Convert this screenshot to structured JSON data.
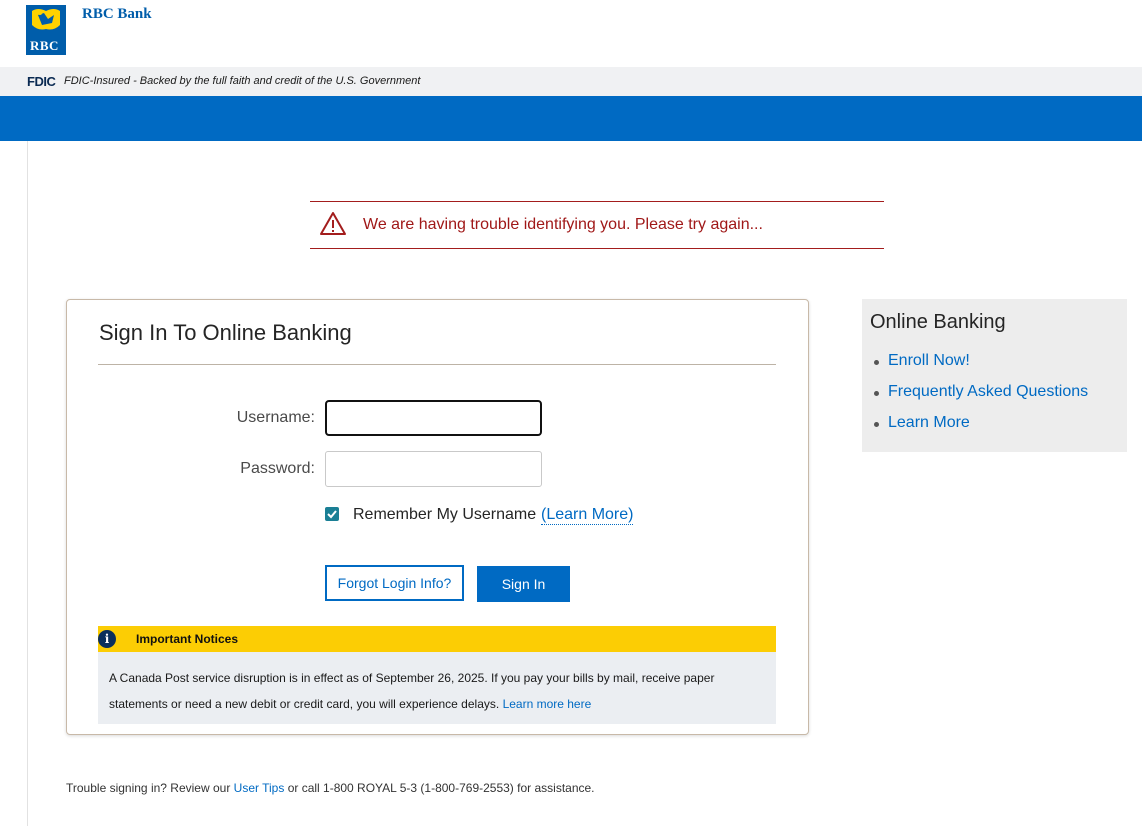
{
  "header": {
    "logo_text": "RBC",
    "brand_name": "RBC Bank",
    "fdic_logo": "FDIC",
    "fdic_text": "FDIC-Insured - Backed by the full faith and credit of the U.S. Government"
  },
  "error": {
    "icon": "warning-triangle-icon",
    "message": "We are having trouble identifying you. Please try again..."
  },
  "signin": {
    "title": "Sign In To Online Banking",
    "username_label": "Username:",
    "username_value": "",
    "password_label": "Password:",
    "password_value": "",
    "remember_checked": true,
    "remember_label": "Remember My Username",
    "learn_more_label": "(Learn More)",
    "forgot_button": "Forgot Login Info?",
    "signin_button": "Sign In"
  },
  "notice": {
    "icon": "info-icon",
    "icon_glyph": "i",
    "title": "Important Notices",
    "text": "A Canada Post service disruption is in effect as of September 26, 2025. If you pay your bills by mail, receive paper statements or need a new debit or credit card, you will experience delays.",
    "link": "Learn more here"
  },
  "panel": {
    "title": "Online Banking",
    "links": [
      "Enroll Now!",
      "Frequently Asked Questions",
      "Learn More"
    ]
  },
  "footer": {
    "prefix": "Trouble signing in? Review our",
    "link": "User Tips",
    "suffix": "or call 1-800 ROYAL 5-3 (1-800-769-2553) for assistance."
  },
  "colors": {
    "brand_blue": "#006ac3",
    "error_red": "#a01818",
    "notice_yellow": "#fccd04"
  }
}
